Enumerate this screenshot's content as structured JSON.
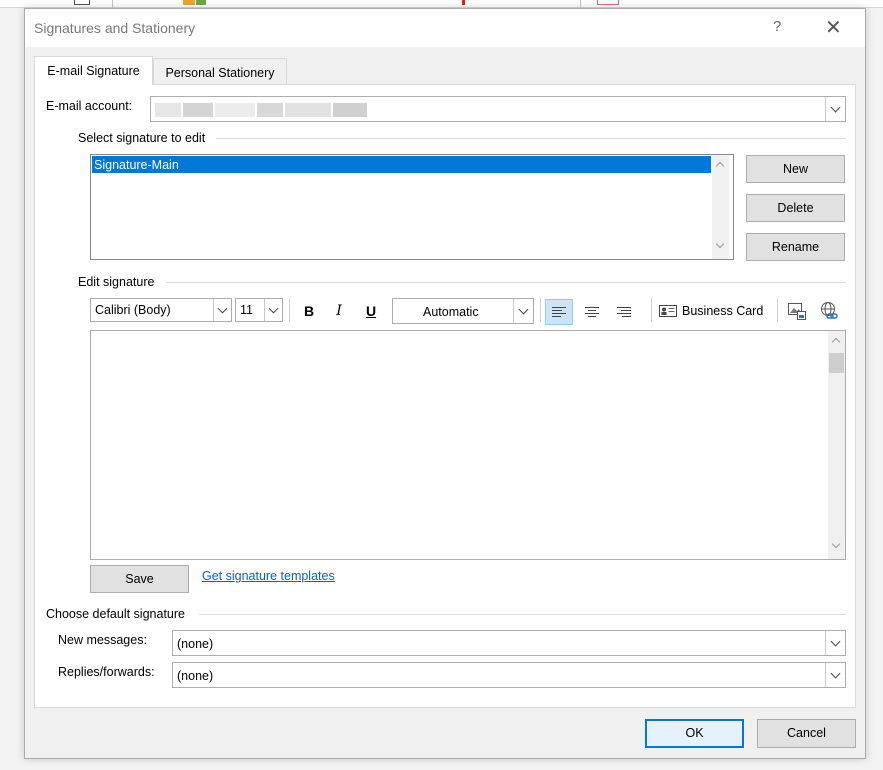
{
  "dialog": {
    "title": "Signatures and Stationery",
    "help_label": "?",
    "close_label": "✕"
  },
  "tabs": [
    {
      "label": "E-mail Signature",
      "active": true
    },
    {
      "label": "Personal Stationery",
      "active": false
    }
  ],
  "account": {
    "label": "E-mail account:",
    "value": ""
  },
  "select_signature": {
    "group_label": "Select signature to edit",
    "items": [
      "Signature-Main"
    ],
    "selected_index": 0,
    "buttons": {
      "new": "New",
      "delete": "Delete",
      "rename": "Rename"
    }
  },
  "edit_signature": {
    "group_label": "Edit signature",
    "font": "Calibri (Body)",
    "size": "11",
    "bold": "B",
    "italic": "I",
    "underline": "U",
    "color": "Automatic",
    "business_card": "Business Card",
    "body_text": "",
    "save_label": "Save",
    "templates_link": "Get signature templates"
  },
  "defaults": {
    "group_label": "Choose default signature",
    "new_messages_label": "New messages:",
    "new_messages_value": "(none)",
    "replies_label": "Replies/forwards:",
    "replies_value": "(none)"
  },
  "footer": {
    "ok": "OK",
    "cancel": "Cancel"
  },
  "colors": {
    "accent": "#0078d7",
    "link": "#0563c1",
    "selection": "#0078d7"
  }
}
